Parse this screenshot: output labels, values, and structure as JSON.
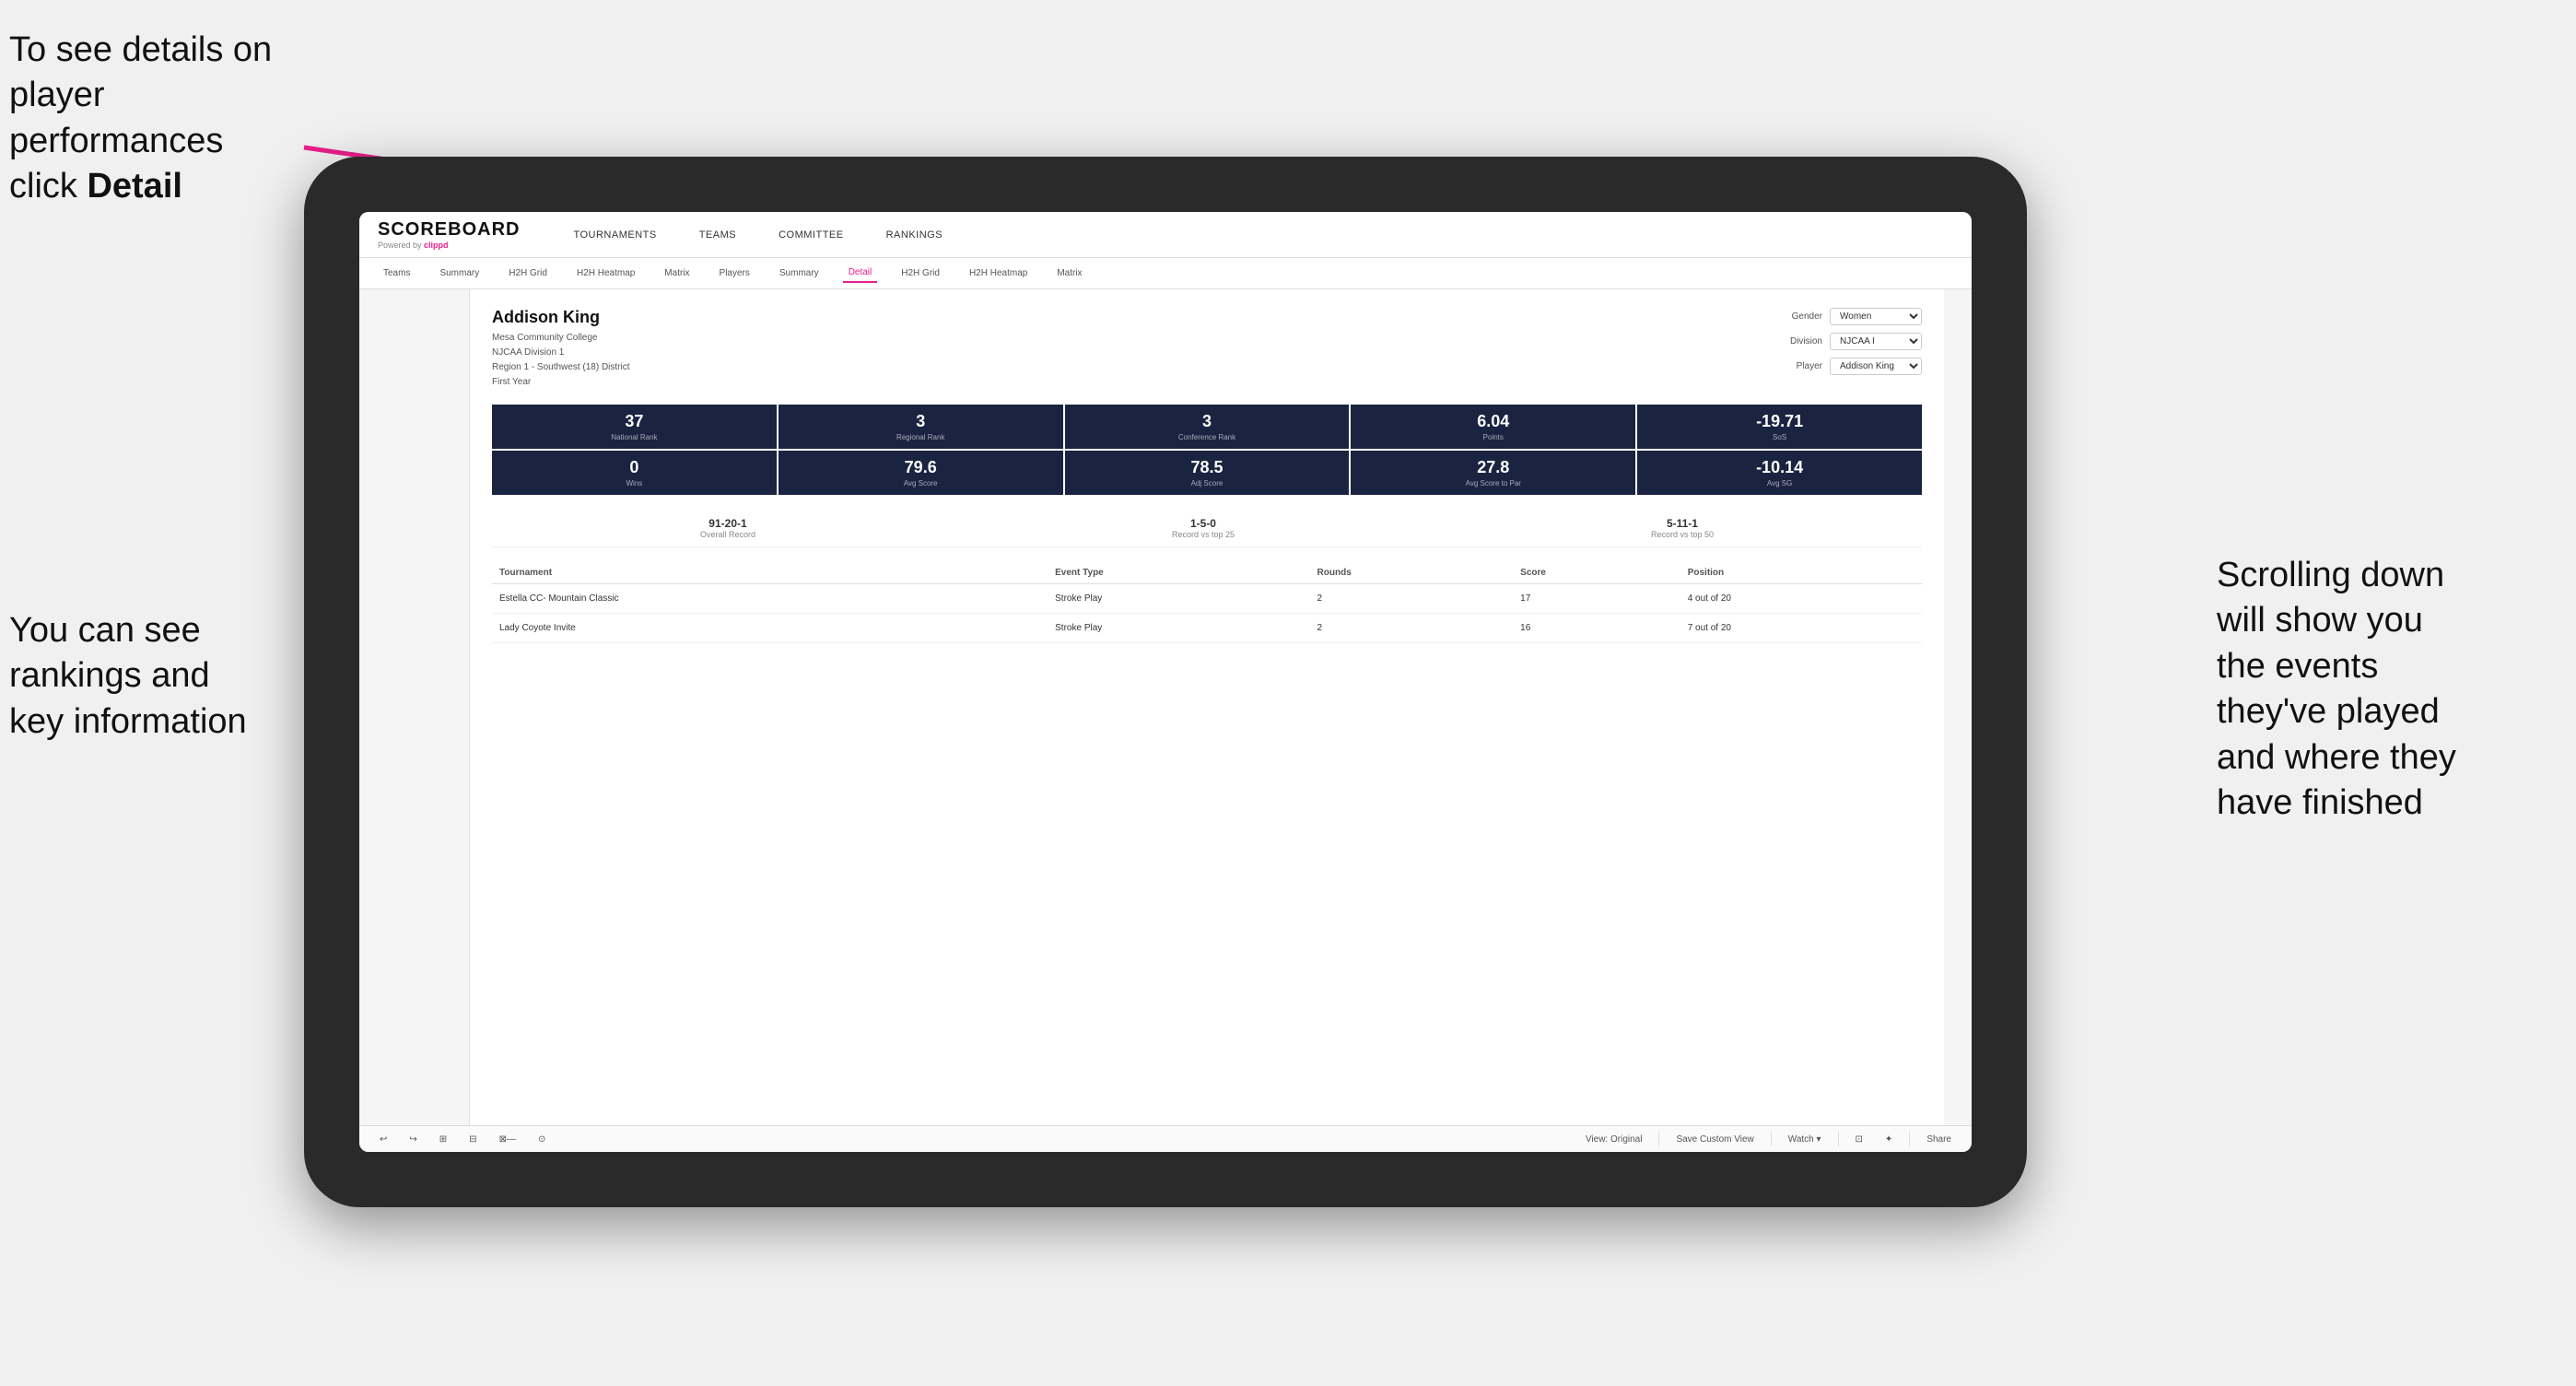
{
  "annotations": {
    "topleft": {
      "line1": "To see details on",
      "line2": "player performances",
      "line3_pre": "click ",
      "line3_bold": "Detail"
    },
    "bottomleft": {
      "line1": "You can see",
      "line2": "rankings and",
      "line3": "key information"
    },
    "bottomright": {
      "line1": "Scrolling down",
      "line2": "will show you",
      "line3": "the events",
      "line4": "they've played",
      "line5": "and where they",
      "line6": "have finished"
    }
  },
  "nav": {
    "logo": "SCOREBOARD",
    "powered_by": "Powered by",
    "clippd": "clippd",
    "items": [
      "TOURNAMENTS",
      "TEAMS",
      "COMMITTEE",
      "RANKINGS"
    ]
  },
  "subnav": {
    "items": [
      "Teams",
      "Summary",
      "H2H Grid",
      "H2H Heatmap",
      "Matrix",
      "Players",
      "Summary",
      "Detail",
      "H2H Grid",
      "H2H Heatmap",
      "Matrix"
    ],
    "active_index": 7
  },
  "player": {
    "name": "Addison King",
    "college": "Mesa Community College",
    "division": "NJCAA Division 1",
    "region": "Region 1 - Southwest (18) District",
    "year": "First Year"
  },
  "filters": {
    "gender_label": "Gender",
    "gender_value": "Women",
    "division_label": "Division",
    "division_value": "NJCAA I",
    "player_label": "Player",
    "player_value": "Addison King"
  },
  "stats_row1": [
    {
      "value": "37",
      "label": "National Rank"
    },
    {
      "value": "3",
      "label": "Regional Rank"
    },
    {
      "value": "3",
      "label": "Conference Rank"
    },
    {
      "value": "6.04",
      "label": "Points"
    },
    {
      "value": "-19.71",
      "label": "SoS"
    }
  ],
  "stats_row2": [
    {
      "value": "0",
      "label": "Wins"
    },
    {
      "value": "79.6",
      "label": "Avg Score"
    },
    {
      "value": "78.5",
      "label": "Adj Score"
    },
    {
      "value": "27.8",
      "label": "Avg Score to Par"
    },
    {
      "value": "-10.14",
      "label": "Avg SG"
    }
  ],
  "records": [
    {
      "value": "91-20-1",
      "label": "Overall Record"
    },
    {
      "value": "1-5-0",
      "label": "Record vs top 25"
    },
    {
      "value": "5-11-1",
      "label": "Record vs top 50"
    }
  ],
  "table": {
    "headers": [
      "Tournament",
      "Event Type",
      "Rounds",
      "Score",
      "Position"
    ],
    "rows": [
      {
        "tournament": "Estella CC- Mountain Classic",
        "event_type": "Stroke Play",
        "rounds": "2",
        "score": "17",
        "position": "4 out of 20"
      },
      {
        "tournament": "Lady Coyote Invite",
        "event_type": "Stroke Play",
        "rounds": "2",
        "score": "16",
        "position": "7 out of 20"
      }
    ]
  },
  "toolbar": {
    "buttons": [
      "↩",
      "↪",
      "⊞",
      "⊟",
      "⊠",
      "⊡",
      "⊙",
      "View: Original",
      "Save Custom View",
      "Watch ▾",
      "⊡",
      "✦",
      "Share"
    ]
  }
}
